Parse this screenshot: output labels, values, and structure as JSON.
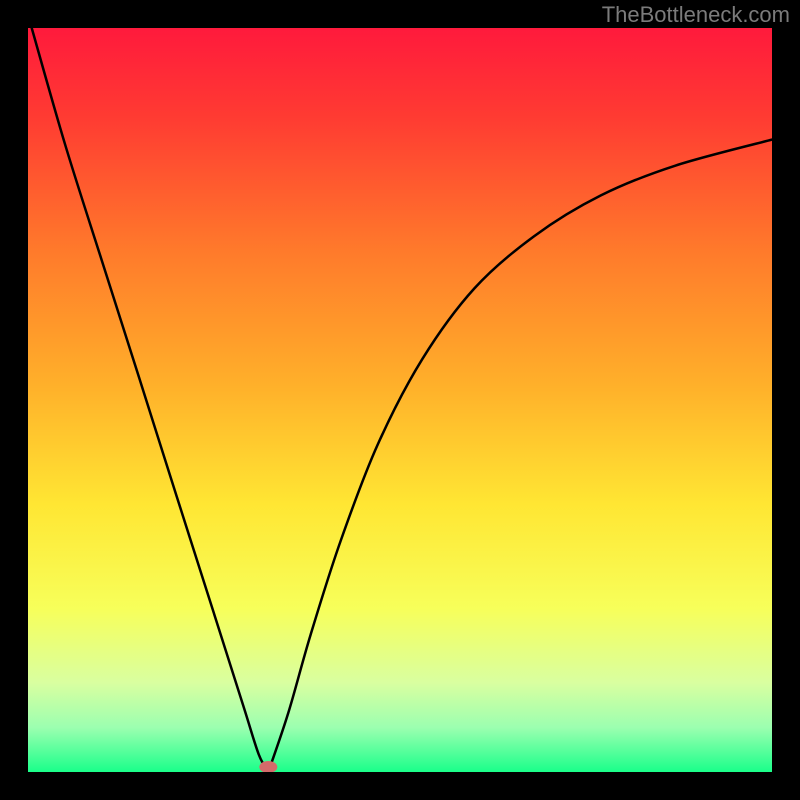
{
  "watermark": "TheBottleneck.com",
  "chart_data": {
    "type": "line",
    "title": "",
    "xlabel": "",
    "ylabel": "",
    "xlim": [
      0,
      1
    ],
    "ylim": [
      0,
      1
    ],
    "background_gradient": {
      "stops": [
        {
          "pos": 0.0,
          "color": "#ff1a3c"
        },
        {
          "pos": 0.12,
          "color": "#ff3b32"
        },
        {
          "pos": 0.3,
          "color": "#ff7a2b"
        },
        {
          "pos": 0.48,
          "color": "#ffb02a"
        },
        {
          "pos": 0.64,
          "color": "#ffe633"
        },
        {
          "pos": 0.78,
          "color": "#f7ff5a"
        },
        {
          "pos": 0.88,
          "color": "#d9ffa0"
        },
        {
          "pos": 0.94,
          "color": "#9cffb0"
        },
        {
          "pos": 1.0,
          "color": "#1aff8a"
        }
      ]
    },
    "series": [
      {
        "name": "left-branch",
        "x": [
          0.005,
          0.05,
          0.1,
          0.15,
          0.2,
          0.25,
          0.29,
          0.31,
          0.323
        ],
        "y": [
          1.0,
          0.843,
          0.685,
          0.528,
          0.37,
          0.213,
          0.087,
          0.024,
          0.0
        ]
      },
      {
        "name": "right-branch",
        "x": [
          0.323,
          0.35,
          0.38,
          0.42,
          0.47,
          0.53,
          0.6,
          0.68,
          0.77,
          0.87,
          1.0
        ],
        "y": [
          0.0,
          0.08,
          0.185,
          0.31,
          0.44,
          0.555,
          0.65,
          0.72,
          0.775,
          0.815,
          0.85
        ]
      }
    ],
    "marker": {
      "x": 0.323,
      "y": 0.0,
      "rx": 9,
      "ry": 6,
      "color": "#d46a6a"
    }
  }
}
